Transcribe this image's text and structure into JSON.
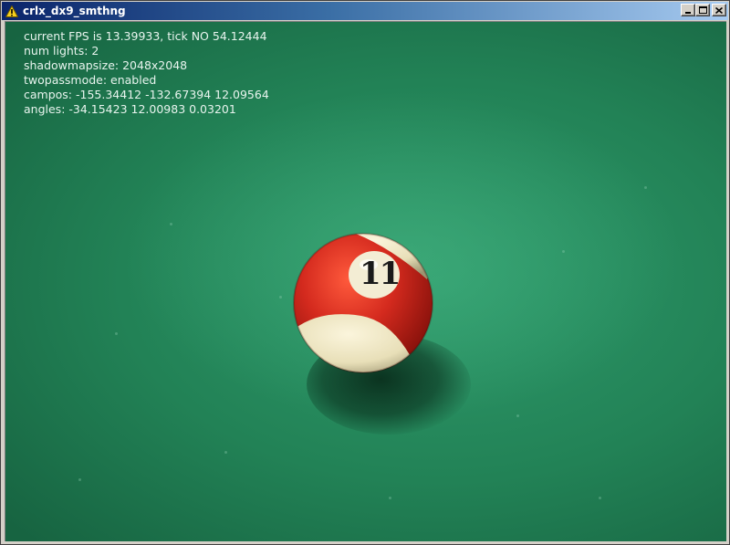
{
  "window": {
    "title": "crlx_dx9_smthng",
    "icon": "warning-icon",
    "controls": [
      "minimize-icon",
      "maximize-icon",
      "close-icon"
    ]
  },
  "overlay": {
    "fps_line": "current FPS is 13.39933, tick NO 54.12444",
    "lights_line": "num lights: 2",
    "shadowmap_line": "shadowmapsize: 2048x2048",
    "twopass_line": "twopassmode: enabled",
    "campos_line": "campos: -155.34412 -132.67394 12.09564",
    "angles_line": "angles: -34.15423 12.00983 0.03201"
  },
  "scene": {
    "ball_number": "11",
    "ball_color": "#d42a1e",
    "ball_stripe_base": "#efe7c6",
    "felt_color": "#228256"
  }
}
